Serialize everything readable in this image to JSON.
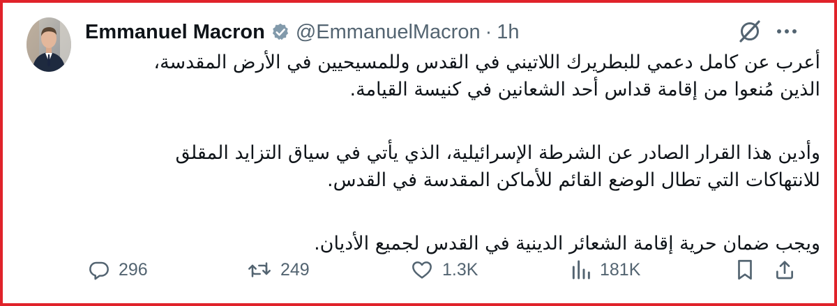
{
  "colors": {
    "frame_border": "#e0222a",
    "verified_badge": "#829aab",
    "secondary_text": "#536471"
  },
  "author": {
    "display_name": "Emmanuel Macron",
    "handle": "@EmmanuelMacron",
    "separator": "·",
    "timestamp": "1h",
    "verified_icon": "verified-badge-icon",
    "avatar_icon": "profile-photo"
  },
  "header_icons": {
    "grok": "grok-slash-icon",
    "more": "more-dots-icon"
  },
  "post": {
    "paragraphs": [
      [
        "أعرب عن كامل دعمي للبطريرك اللاتيني في القدس وللمسيحيين في الأرض المقدسة،",
        "الذين مُنعوا من إقامة قداس أحد الشعانين في كنيسة القيامة."
      ],
      [
        "وأدين هذا القرار الصادر عن الشرطة الإسرائيلية، الذي يأتي في سياق التزايد المقلق",
        "للانتهاكات التي تطال الوضع القائم للأماكن المقدسة في القدس."
      ],
      [
        "ويجب ضمان حرية إقامة الشعائر الدينية في القدس لجميع الأديان."
      ]
    ]
  },
  "actions": {
    "replies": {
      "icon": "reply-icon",
      "count": "296"
    },
    "reposts": {
      "icon": "repost-icon",
      "count": "249"
    },
    "likes": {
      "icon": "heart-icon",
      "count": "1.3K"
    },
    "views": {
      "icon": "views-chart-icon",
      "count": "181K"
    },
    "bookmark": {
      "icon": "bookmark-icon"
    },
    "share": {
      "icon": "share-icon"
    }
  }
}
